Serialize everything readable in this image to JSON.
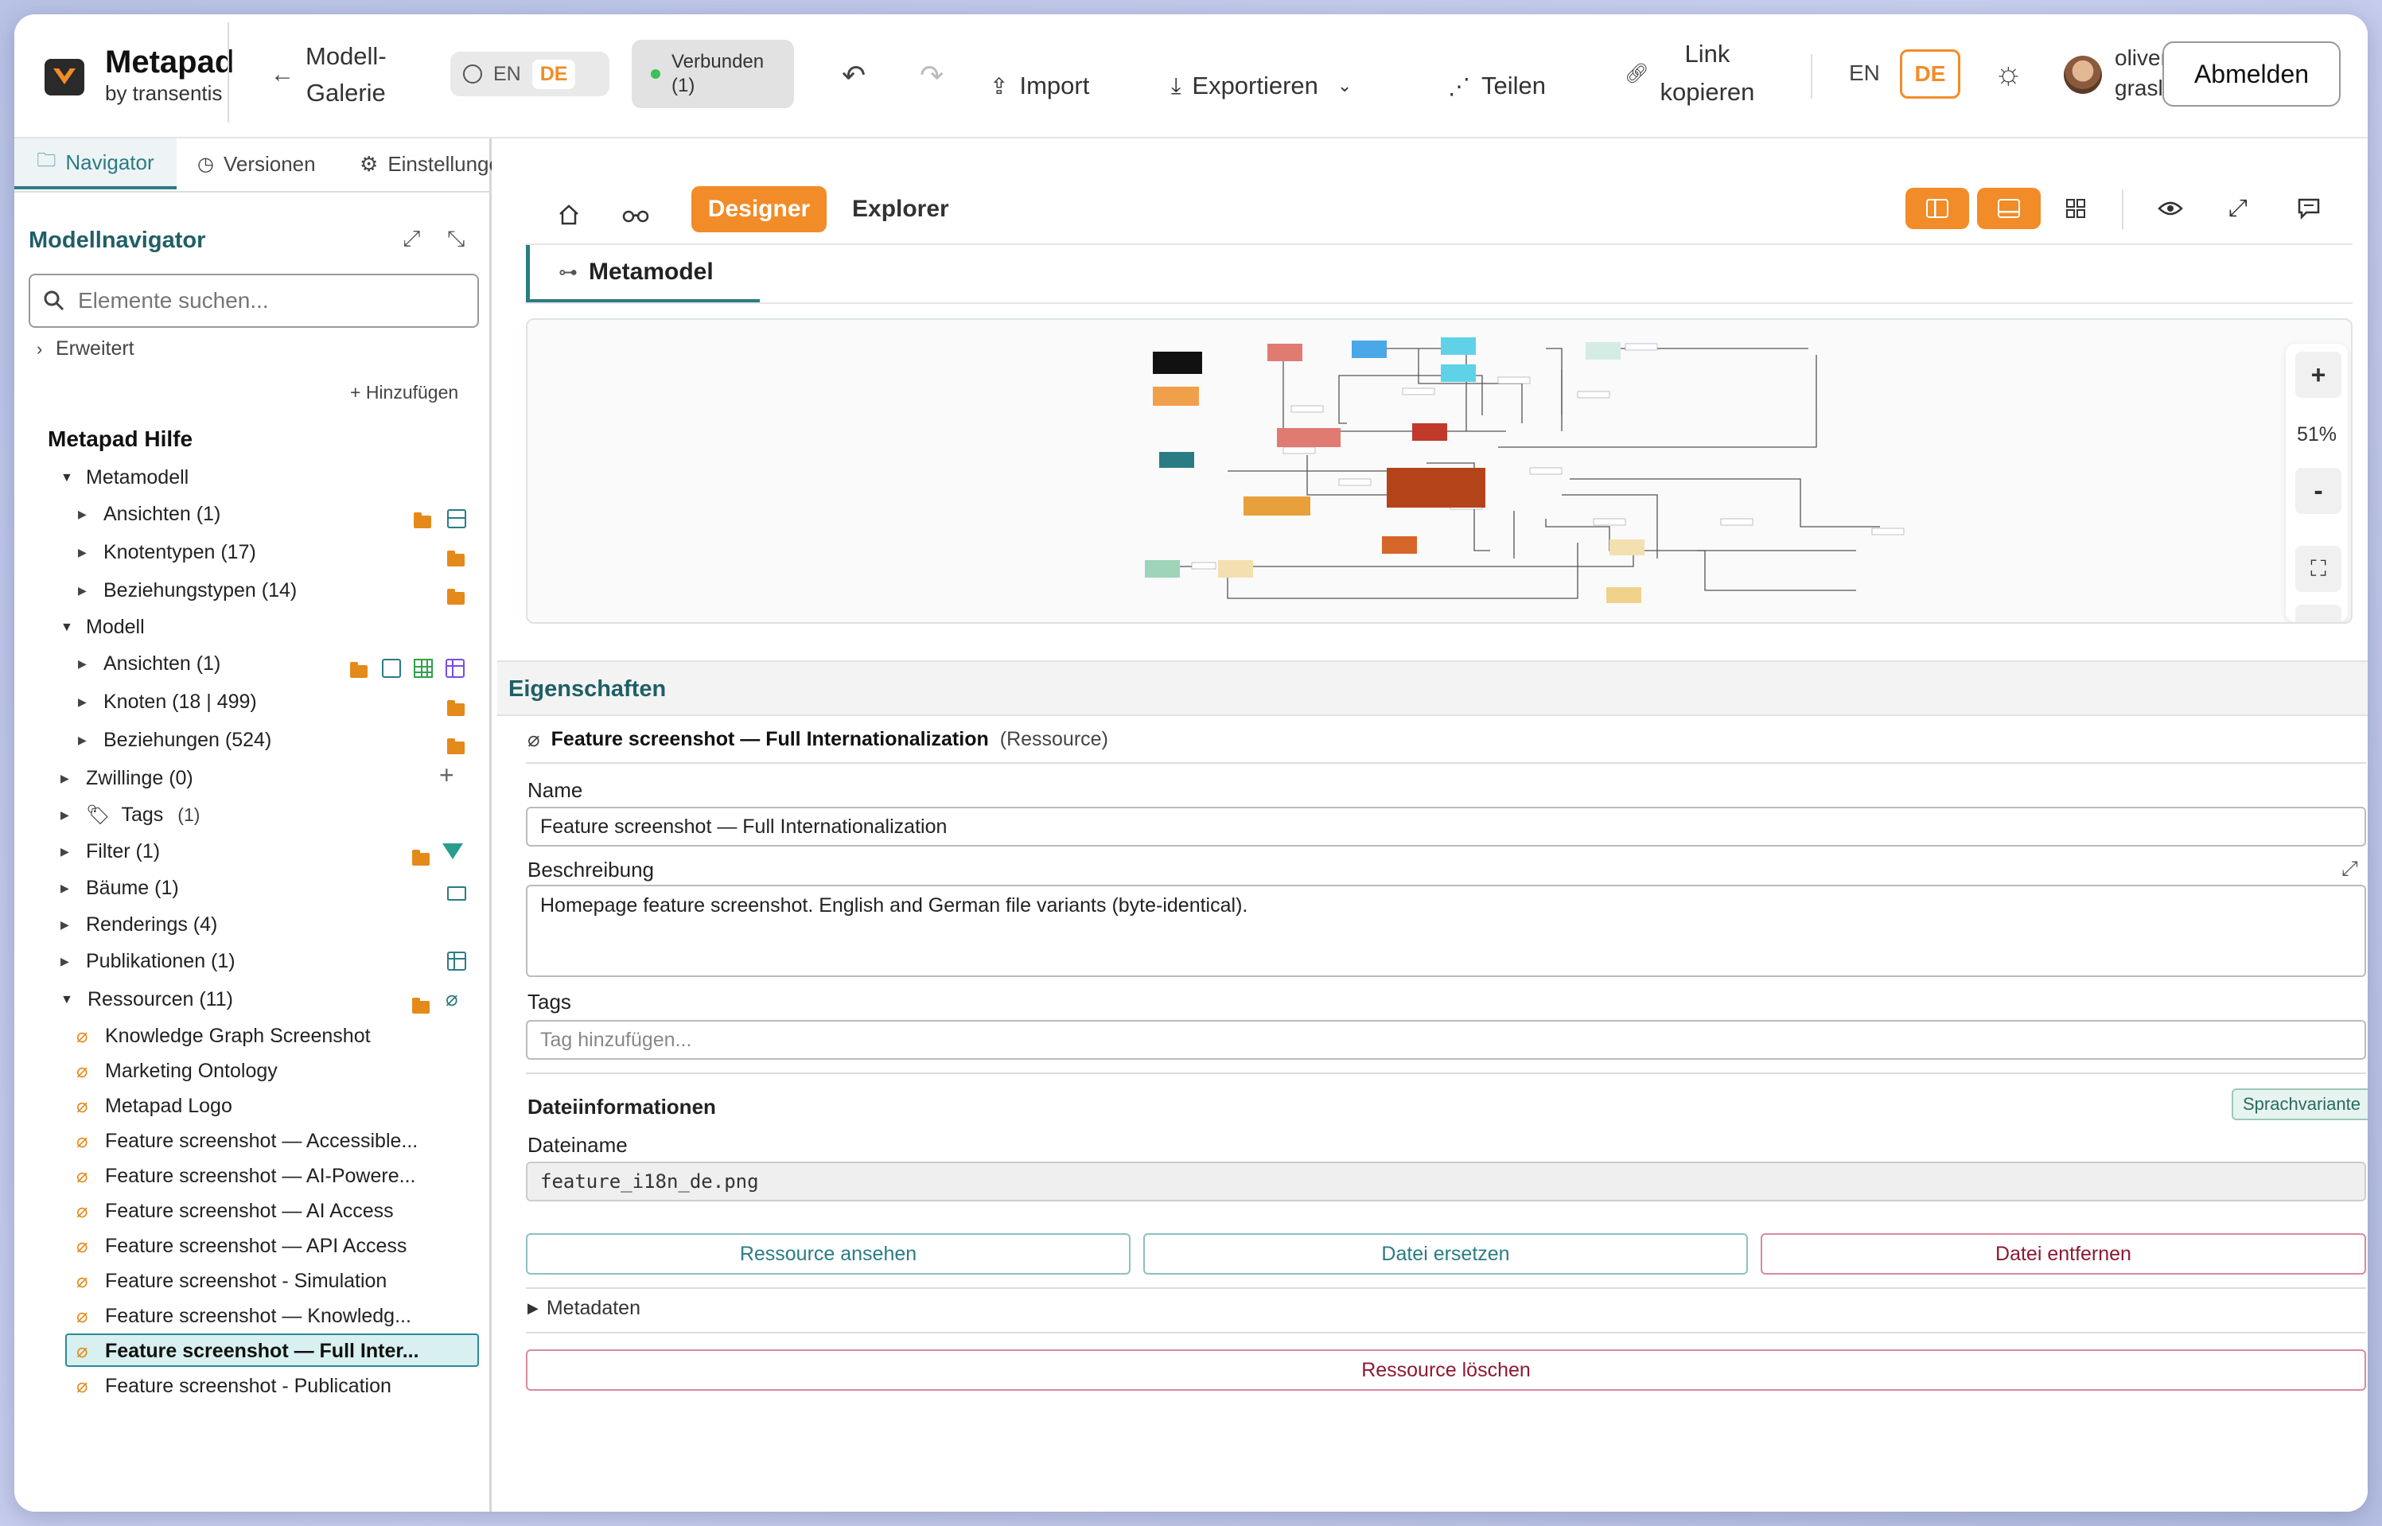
{
  "app": {
    "name": "Metapad",
    "subtitle": "by transentis"
  },
  "header": {
    "gallery_line1": "Modell-",
    "gallery_line2": "Galerie",
    "lang_en": "EN",
    "lang_de": "DE",
    "connected_line1": "Verbunden",
    "connected_line2": "(1)",
    "import": "Import",
    "export": "Exportieren",
    "share": "Teilen",
    "copy_link_line1": "Link",
    "copy_link_line2": "kopieren",
    "ui_lang_en": "EN",
    "ui_lang_de": "DE",
    "user_line1": "oliver",
    "user_line2": "grasl",
    "logout": "Abmelden",
    "colors": {
      "accent": "#f28c28",
      "connected": "#3cc05a"
    }
  },
  "sidebar": {
    "tabs": [
      "Navigator",
      "Versionen",
      "Einstellungen"
    ],
    "title": "Modellnavigator",
    "search_placeholder": "Elemente suchen...",
    "advanced": "Erweitert",
    "add": "+ Hinzufügen",
    "project": "Metapad Hilfe",
    "metamodel": {
      "label": "Metamodell",
      "children": [
        "Ansichten (1)",
        "Knotentypen (17)",
        "Beziehungstypen (14)"
      ]
    },
    "model": {
      "label": "Modell",
      "children": [
        "Ansichten (1)",
        "Knoten (18 | 499)",
        "Beziehungen (524)"
      ]
    },
    "twins": "Zwillinge (0)",
    "tags": "Tags",
    "tags_count": "(1)",
    "filter": "Filter (1)",
    "trees": "Bäume (1)",
    "renderings": "Renderings (4)",
    "publications": "Publikationen (1)",
    "resources": "Ressourcen (11)",
    "resource_items": [
      "Knowledge Graph Screenshot",
      "Marketing Ontology",
      "Metapad Logo",
      "Feature screenshot — Accessible...",
      "Feature screenshot — AI-Powere...",
      "Feature screenshot — AI Access",
      "Feature screenshot — API Access",
      "Feature screenshot - Simulation",
      "Feature screenshot — Knowledg...",
      "Feature screenshot — Full Inter...",
      "Feature screenshot - Publication"
    ],
    "selected_index": 9
  },
  "toolbar": {
    "designer": "Designer",
    "explorer": "Explorer"
  },
  "canvas": {
    "tab": "Metamodel",
    "zoom": "51%",
    "zoom_in": "+",
    "zoom_out": "-"
  },
  "properties": {
    "title": "Eigenschaften",
    "resource_name": "Feature screenshot — Full Internationalization",
    "resource_type": "(Ressource)",
    "name_label": "Name",
    "name_value": "Feature screenshot — Full Internationalization",
    "desc_label": "Beschreibung",
    "desc_value": "Homepage feature screenshot. English and German file variants (byte-identical).",
    "tags_label": "Tags",
    "tags_placeholder": "Tag hinzufügen...",
    "file_info": "Dateiinformationen",
    "language_variant": "Sprachvariante",
    "filename_label": "Dateiname",
    "filename_value": "feature_i18n_de.png",
    "view_btn": "Ressource ansehen",
    "replace_btn": "Datei ersetzen",
    "remove_btn": "Datei entfernen",
    "metadata": "Metadaten",
    "delete_btn": "Ressource löschen"
  }
}
